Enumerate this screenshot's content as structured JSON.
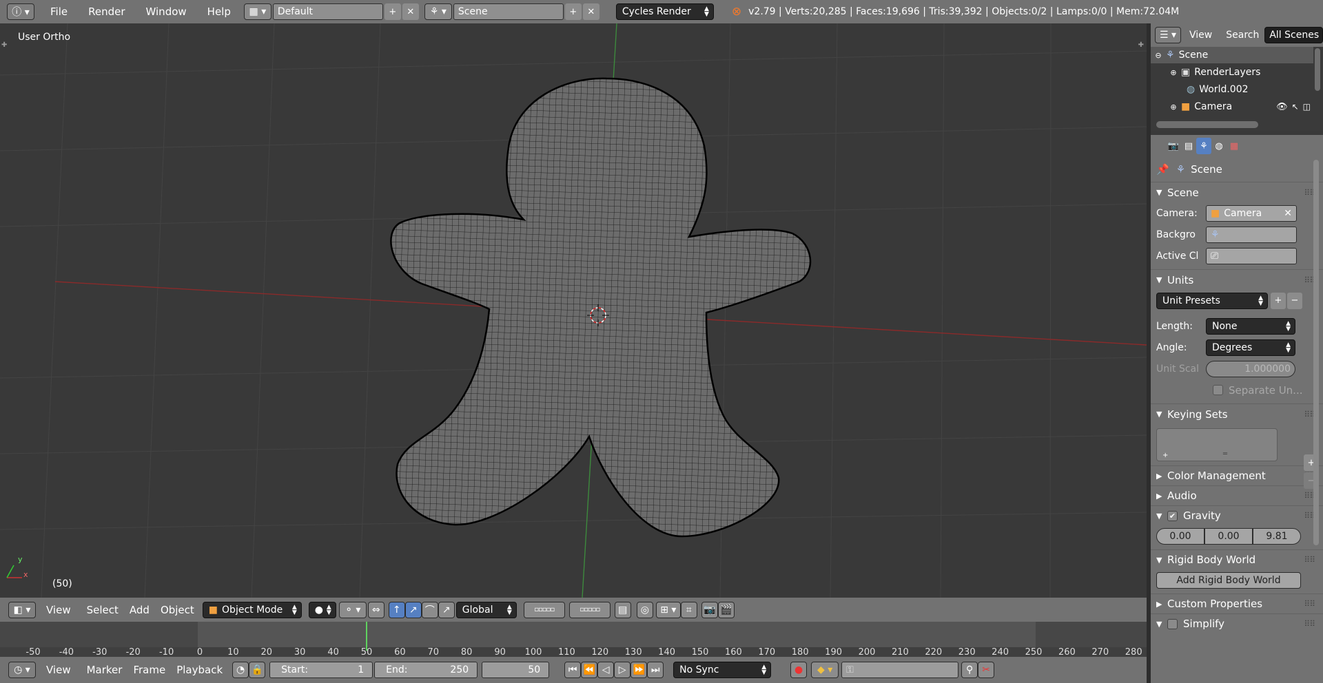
{
  "topbar": {
    "menus": [
      "File",
      "Render",
      "Window",
      "Help"
    ],
    "layout": "Default",
    "scene": "Scene",
    "engine": "Cycles Render",
    "stats": "v2.79 | Verts:20,285 | Faces:19,696 | Tris:39,392 | Objects:0/2 | Lamps:0/0 | Mem:72.04M"
  },
  "viewport": {
    "view_label": "User Ortho",
    "frame_label": "(50)",
    "axis_x": "x",
    "axis_y": "y"
  },
  "view3d_header": {
    "menus": [
      "View",
      "Select",
      "Add",
      "Object"
    ],
    "mode": "Object Mode",
    "orientation": "Global"
  },
  "timeline": {
    "ticks": [
      "-50",
      "-40",
      "-30",
      "-20",
      "-10",
      "0",
      "10",
      "20",
      "30",
      "40",
      "50",
      "60",
      "70",
      "80",
      "90",
      "100",
      "110",
      "120",
      "130",
      "140",
      "150",
      "160",
      "170",
      "180",
      "190",
      "200",
      "210",
      "220",
      "230",
      "240",
      "250",
      "260",
      "270",
      "280"
    ],
    "current_frame": 50
  },
  "timeline_header": {
    "menus": [
      "View",
      "Marker",
      "Frame",
      "Playback"
    ],
    "start_label": "Start:",
    "start": "1",
    "end_label": "End:",
    "end": "250",
    "current": "50",
    "sync": "No Sync"
  },
  "outliner": {
    "header": {
      "view": "View",
      "search": "Search",
      "filter": "All Scenes"
    },
    "items": [
      {
        "label": "Scene"
      },
      {
        "label": "RenderLayers"
      },
      {
        "label": "World.002"
      },
      {
        "label": "Camera"
      }
    ]
  },
  "properties": {
    "context_label": "Scene",
    "scene_panel": {
      "title": "Scene",
      "camera_label": "Camera:",
      "camera_value": "Camera",
      "background_label": "Backgro",
      "active_clip_label": "Active Cl"
    },
    "units_panel": {
      "title": "Units",
      "presets": "Unit Presets",
      "length_label": "Length:",
      "length_value": "None",
      "angle_label": "Angle:",
      "angle_value": "Degrees",
      "scale_label": "Unit Scal",
      "scale_value": "1.000000",
      "separate_label": "Separate Un..."
    },
    "keying_panel": {
      "title": "Keying Sets"
    },
    "color_mgmt": "Color Management",
    "audio": "Audio",
    "gravity": {
      "title": "Gravity",
      "x": "0.00",
      "y": "0.00",
      "z": "9.81"
    },
    "rigid_body": {
      "title": "Rigid Body World",
      "button": "Add Rigid Body World"
    },
    "custom_props": "Custom Properties",
    "simplify": "Simplify"
  },
  "colors": {
    "header": "#727272",
    "viewport": "#393939",
    "frame_marker": "#5fd35f",
    "selected": "#5680c2"
  }
}
